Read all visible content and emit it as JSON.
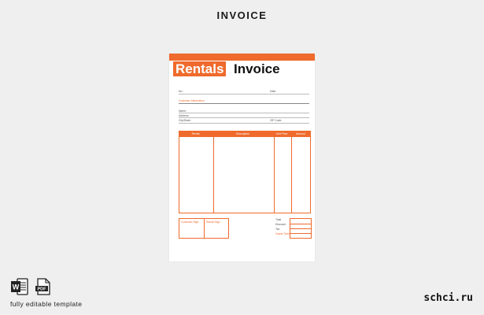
{
  "page": {
    "title": "INVOICE"
  },
  "invoice": {
    "brand_primary": "Rentals",
    "brand_secondary": "Invoice",
    "no_label": "No.:",
    "date_label": "Date:",
    "customer_section": "Customer Information",
    "name_label": "Name:",
    "address_label": "Address:",
    "city_label": "City/State:",
    "zip_label": "ZIP Code:",
    "columns": [
      "Rental",
      "Description",
      "Unit Price",
      "Amount"
    ],
    "sig_labels": [
      "Customer Sign",
      "Rental Sign"
    ],
    "totals_labels": [
      "Total",
      "Discount",
      "Tax",
      "Grand Total"
    ]
  },
  "footer": {
    "caption": "fully editable template",
    "site": "schci.ru",
    "word_icon_letter": "W",
    "pdf_icon_text": "PDF"
  },
  "colors": {
    "accent": "#ef6a2c",
    "background": "#efefef"
  }
}
